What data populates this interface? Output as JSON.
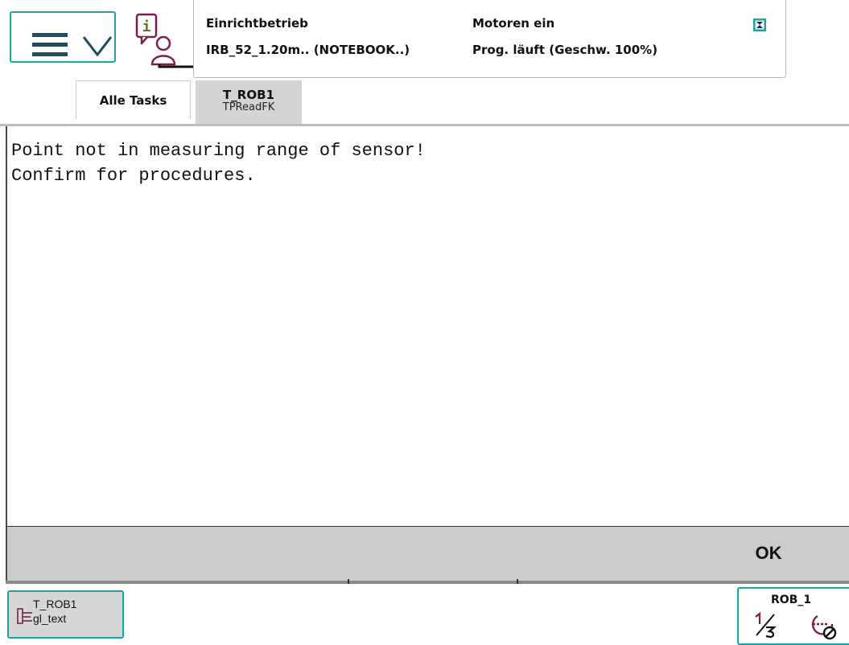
{
  "header": {
    "menu_icons": [
      "hamburger-icon",
      "chevron-down-icon"
    ],
    "status": {
      "mode": "Einrichtbetrieb",
      "system": "IRB_52_1.20m.. (NOTEBOOK..)",
      "motors": "Motoren ein",
      "program": "Prog. läuft (Geschw. 100%)"
    }
  },
  "tabs": [
    {
      "label": "Alle Tasks"
    },
    {
      "label": "T_ROB1",
      "sublabel": "TPReadFK"
    }
  ],
  "message": {
    "lines": [
      "Point not in measuring range of sensor!",
      "Confirm for procedures."
    ]
  },
  "buttons": {
    "ok": "OK"
  },
  "footer": {
    "task": {
      "line1": "T_ROB1",
      "line2": "gl_text"
    },
    "unit": {
      "label": "ROB_1"
    }
  },
  "colors": {
    "accent": "#1aa3a3",
    "icon_purple": "#7a1f4d",
    "bar_grey": "#cccccc"
  }
}
